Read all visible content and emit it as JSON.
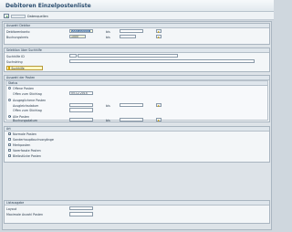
{
  "window": {
    "title": "Debitoren Einzelpostenliste"
  },
  "toolbar": {
    "text_button_label": "Datenquellen"
  },
  "groups": {
    "debtor_selection": {
      "title": "Auswahl Debitor",
      "rows": [
        {
          "label": "Debitorenkonto",
          "from_value_selected": "0000100000",
          "to_label": "bis",
          "to_value": ""
        },
        {
          "label": "Buchungskreis",
          "from_value": "1000",
          "to_label": "bis",
          "to_value": ""
        }
      ]
    },
    "search_help_selection": {
      "title": "Selektion über Suchhilfe",
      "rows": [
        {
          "label": "Suchhilfe ID",
          "value": ""
        },
        {
          "label": "Suchstring",
          "value": ""
        }
      ],
      "search_button": "Suchhilfe"
    },
    "item_selection": {
      "title": "Auswahl der Posten",
      "status_title": "Status",
      "open_items": {
        "label": "Offene Posten",
        "selected": false
      },
      "open_at_key_date": {
        "label": "Offen zum Stichtag",
        "value": "05.12.2014"
      },
      "cleared_items": {
        "label": "Ausgeglichene Posten",
        "selected": false
      },
      "clearing_date": {
        "label": "Ausgleichsdatum",
        "to_label": "bis",
        "value": "",
        "to_value": ""
      },
      "open_at_key_date_2": {
        "label": "Offen zum Stichtag",
        "value": ""
      },
      "all_items": {
        "label": "Alle Posten",
        "selected": true
      },
      "posting_date": {
        "label": "Buchungsdatum",
        "to_label": "bis",
        "value": "",
        "to_value": ""
      }
    },
    "type": {
      "title": "Art",
      "options": [
        {
          "label": "Normale Posten",
          "checked": true
        },
        {
          "label": "Sonderhauptbuchvorgänge",
          "checked": false
        },
        {
          "label": "Merkposten",
          "checked": false
        },
        {
          "label": "Vorerfasste Posten",
          "checked": false
        },
        {
          "label": "Bleibstücke Posten",
          "checked": false
        }
      ]
    },
    "list_output": {
      "title": "Listausgabe",
      "rows": [
        {
          "label": "Layout",
          "value": ""
        },
        {
          "label": "Maximale Anzahl Posten",
          "value": ""
        }
      ]
    }
  }
}
